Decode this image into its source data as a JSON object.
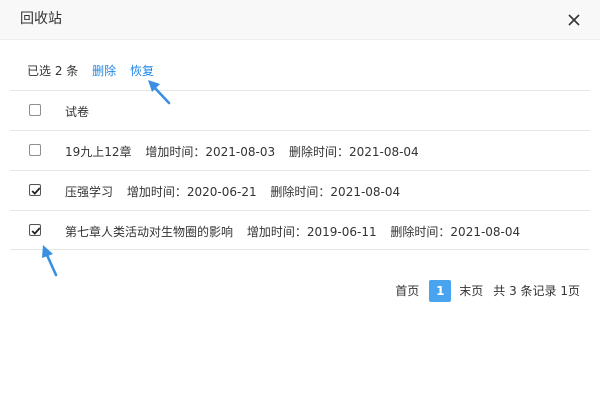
{
  "dialog": {
    "title": "回收站",
    "close_icon": "close-icon"
  },
  "toolbar": {
    "selected_text": "已选 2 条",
    "delete_label": "删除",
    "restore_label": "恢复"
  },
  "table": {
    "header": "试卷",
    "rows": [
      {
        "name": "19九上12章",
        "added": "增加时间：2021-08-03",
        "deleted": "删除时间：2021-08-04",
        "checked": false
      },
      {
        "name": "压强学习",
        "added": "增加时间：2020-06-21",
        "deleted": "删除时间：2021-08-04",
        "checked": true
      },
      {
        "name": "第七章人类活动对生物圈的影响",
        "added": "增加时间：2019-06-11",
        "deleted": "删除时间：2021-08-04",
        "checked": true
      }
    ]
  },
  "pagination": {
    "first": "首页",
    "current": "1",
    "last": "末页",
    "info": "共 3 条记录 1页"
  },
  "colors": {
    "link": "#1e88e5",
    "current_page": "#4aa3ee",
    "arrow": "#3a8fe0"
  }
}
